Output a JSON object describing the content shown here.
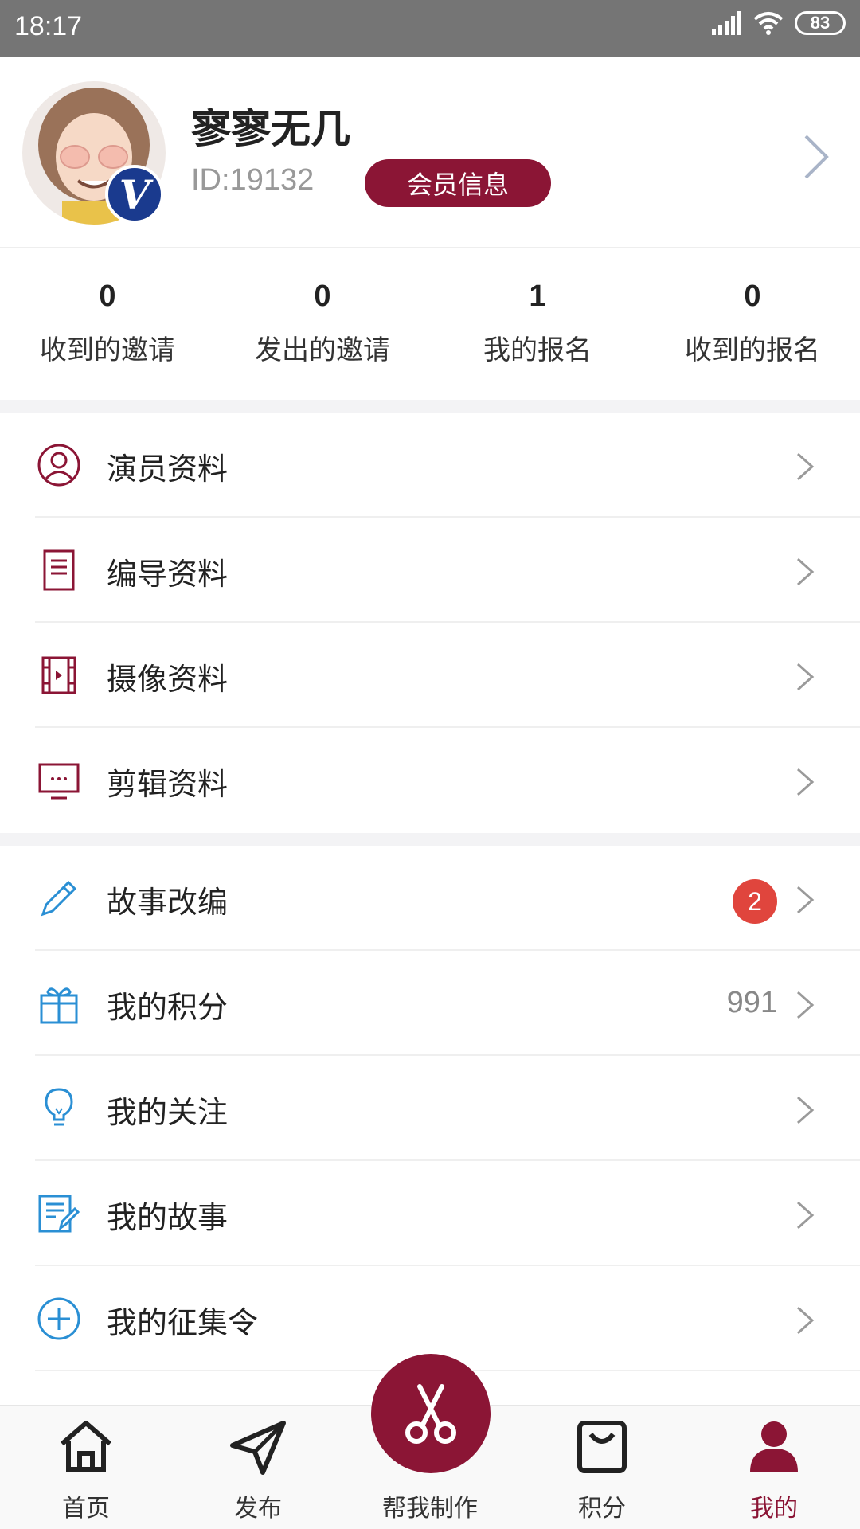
{
  "status_bar": {
    "time": "18:17",
    "battery": "83"
  },
  "profile": {
    "username": "寥寥无几",
    "user_id": "ID:19132",
    "member_button": "会员信息",
    "vip_badge": "V"
  },
  "stats": [
    {
      "value": "0",
      "label": "收到的邀请"
    },
    {
      "value": "0",
      "label": "发出的邀请"
    },
    {
      "value": "1",
      "label": "我的报名"
    },
    {
      "value": "0",
      "label": "收到的报名"
    }
  ],
  "menu_group_1": [
    {
      "label": "演员资料",
      "icon": "user-circle-icon"
    },
    {
      "label": "编导资料",
      "icon": "document-icon"
    },
    {
      "label": "摄像资料",
      "icon": "film-icon"
    },
    {
      "label": "剪辑资料",
      "icon": "monitor-icon"
    }
  ],
  "menu_group_2": [
    {
      "label": "故事改编",
      "icon": "pencil-icon",
      "badge": "2"
    },
    {
      "label": "我的积分",
      "icon": "gift-icon",
      "value": "991"
    },
    {
      "label": "我的关注",
      "icon": "lightbulb-icon"
    },
    {
      "label": "我的故事",
      "icon": "edit-note-icon"
    },
    {
      "label": "我的征集令",
      "icon": "add-circle-icon"
    }
  ],
  "tabbar": [
    {
      "label": "首页",
      "icon": "home-icon"
    },
    {
      "label": "发布",
      "icon": "send-icon"
    },
    {
      "label": "帮我制作",
      "icon": "scissors-icon"
    },
    {
      "label": "积分",
      "icon": "bag-icon"
    },
    {
      "label": "我的",
      "icon": "person-icon",
      "active": true
    }
  ],
  "colors": {
    "brand": "#8b1535",
    "blue_icon": "#2a8fd4",
    "badge_red": "#e0453d",
    "status_bar": "#757575"
  }
}
